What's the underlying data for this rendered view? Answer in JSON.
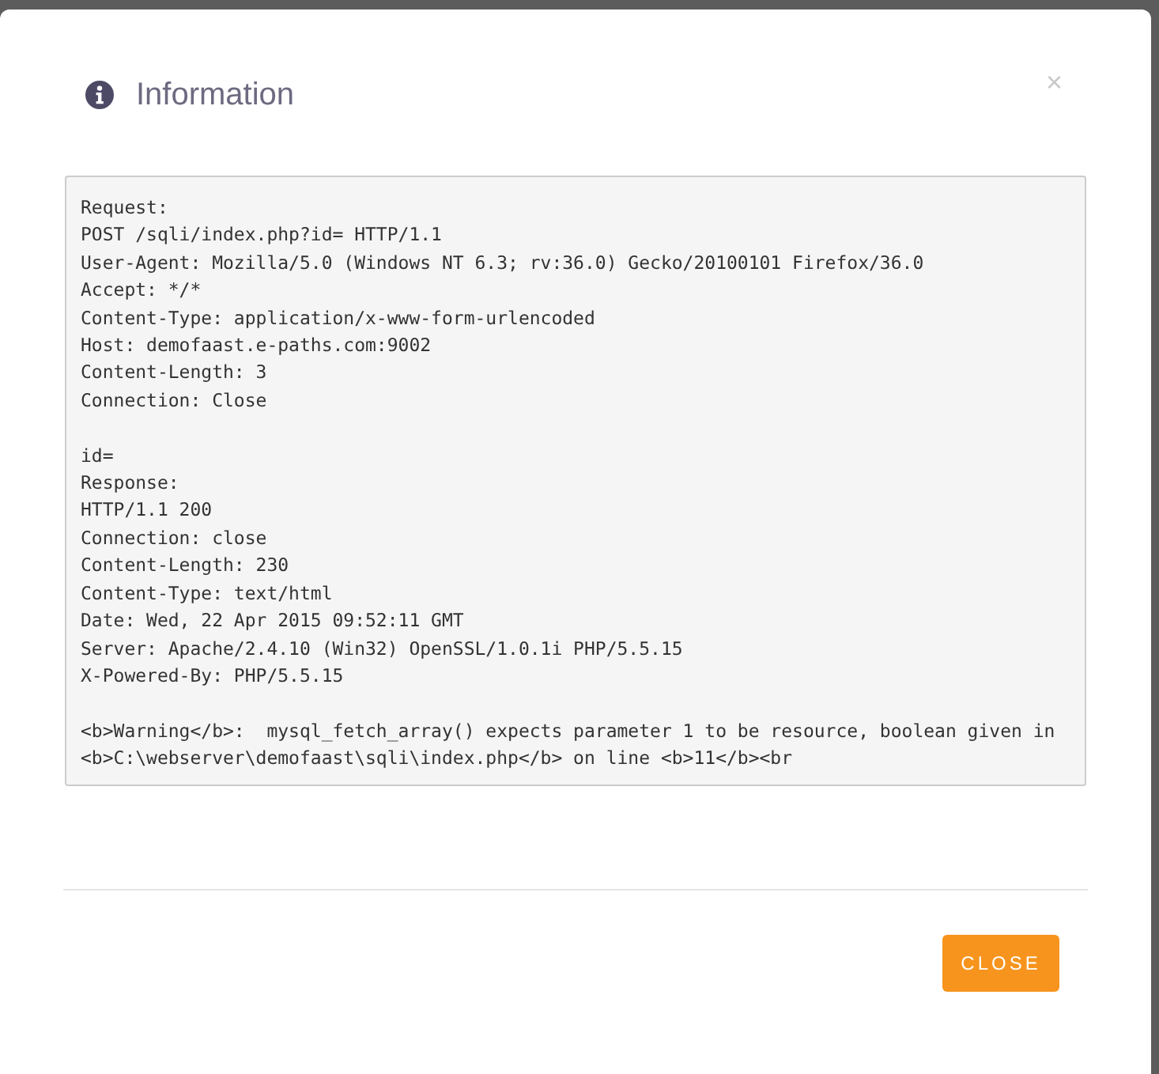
{
  "dialog": {
    "title": "Information",
    "close_symbol": "×",
    "content_blocks": [
      [
        "Request:",
        "POST /sqli/index.php?id= HTTP/1.1",
        "User-Agent: Mozilla/5.0 (Windows NT 6.3; rv:36.0) Gecko/20100101 Firefox/36.0",
        "Accept: */*",
        "Content-Type: application/x-www-form-urlencoded",
        "Host: demofaast.e-paths.com:9002",
        "Content-Length: 3",
        "Connection: Close"
      ],
      [
        "id=",
        "Response:",
        "HTTP/1.1 200",
        "Connection: close",
        "Content-Length: 230",
        "Content-Type: text/html",
        "Date: Wed, 22 Apr 2015 09:52:11 GMT",
        "Server: Apache/2.4.10 (Win32) OpenSSL/1.0.1i PHP/5.5.15",
        "X-Powered-By: PHP/5.5.15"
      ],
      [
        "<b>Warning</b>:  mysql_fetch_array() expects parameter 1 to be resource, boolean given in",
        "<b>C:\\webserver\\demofaast\\sqli\\index.php</b> on line <b>11</b><br"
      ]
    ],
    "buttons": [
      "CLOSE"
    ]
  }
}
